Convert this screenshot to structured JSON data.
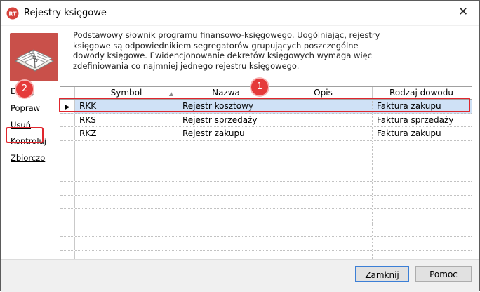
{
  "window": {
    "title": "Rejestry księgowe",
    "close_glyph": "✕",
    "app_icon": "rt-logo-icon"
  },
  "description": "Podstawowy słownik programu finansowo-księgowego. Uogólniając, rejestry księgowe są odpowiednikiem segregatorów grupujących poszczególne dowody księgowe. Ewidencjonowanie dekretów księgowych wymaga więc zdefiniowania co najmniej jednego rejestru księgowego.",
  "side_actions": [
    {
      "label": "Dodaj"
    },
    {
      "label": "Popraw"
    },
    {
      "label": "Usuń"
    },
    {
      "label": "Kontroluj"
    },
    {
      "label": "Zbiorczo"
    }
  ],
  "annotations": {
    "badge_1": "1",
    "badge_2": "2",
    "highlight_color": "#e0262d"
  },
  "grid": {
    "columns": [
      "Symbol",
      "Nazwa",
      "Opis",
      "Rodzaj dowodu"
    ],
    "sort_indicator": "▲",
    "row_pointer": "▶",
    "rows": [
      {
        "symbol": "RKK",
        "nazwa": "Rejestr kosztowy",
        "opis": "",
        "rodzaj": "Faktura zakupu",
        "selected": true
      },
      {
        "symbol": "RKS",
        "nazwa": "Rejestr sprzedaży",
        "opis": "",
        "rodzaj": "Faktura sprzedaży",
        "selected": false
      },
      {
        "symbol": "RKZ",
        "nazwa": "Rejestr zakupu",
        "opis": "",
        "rodzaj": "Faktura zakupu",
        "selected": false
      }
    ],
    "empty_rows": 9
  },
  "buttons": {
    "close": "Zamknij",
    "help": "Pomoc"
  },
  "colors": {
    "selection": "#cfe1f6",
    "accent": "#3c7fd6",
    "book_bg": "#c9504a"
  }
}
